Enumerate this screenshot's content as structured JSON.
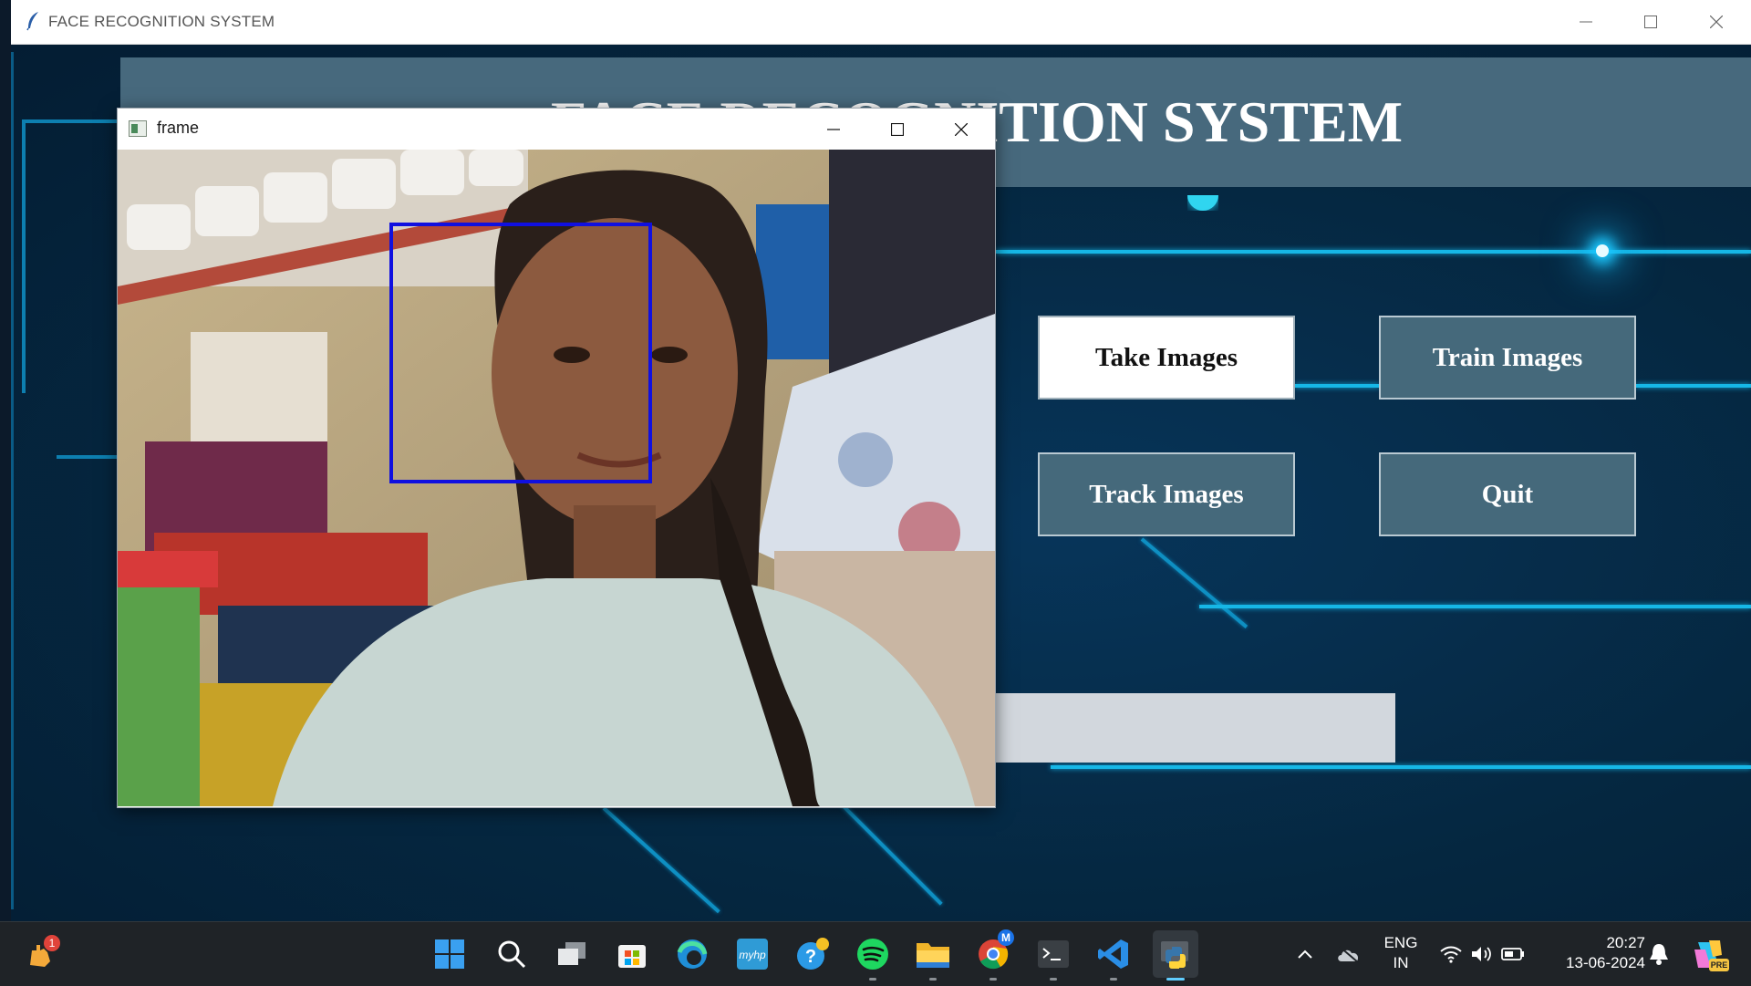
{
  "app": {
    "title": "FACE RECOGNITION SYSTEM",
    "header_title": "FACE RECOGNITION SYSTEM",
    "buttons": {
      "take_images": "Take Images",
      "train_images": "Train Images",
      "track_images": "Track Images",
      "quit": "Quit"
    },
    "colors": {
      "background": "#062a45",
      "header_band": "#47697d",
      "button": "#45697b",
      "trace": "#16b7e6"
    }
  },
  "frame_window": {
    "title": "frame",
    "face_box_color": "#1010e0"
  },
  "taskbar": {
    "notification_badge": "1",
    "chrome_badge": "M",
    "language_line1": "ENG",
    "language_line2": "IN",
    "time": "20:27",
    "date": "13-06-2024",
    "copilot_badge": "PRE",
    "icons": [
      "start-icon",
      "search-icon",
      "task-view-icon",
      "microsoft-store-icon",
      "edge-icon",
      "myhp-icon",
      "get-help-icon",
      "spotify-icon",
      "file-explorer-icon",
      "chrome-icon",
      "terminal-icon",
      "vscode-icon",
      "python-icon"
    ]
  }
}
